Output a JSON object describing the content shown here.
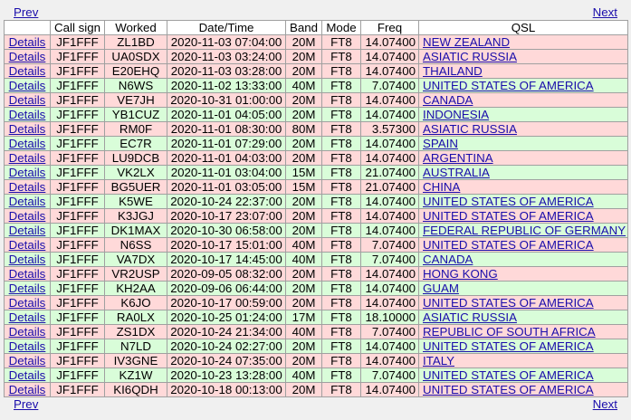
{
  "nav": {
    "prev": "Prev",
    "next": "Next"
  },
  "columns": [
    "",
    "Call sign",
    "Worked",
    "Date/Time",
    "Band",
    "Mode",
    "Freq",
    "QSL"
  ],
  "rows": [
    {
      "details": "Details",
      "call": "JF1FFF",
      "worked": "ZL1BD",
      "datetime": "2020-11-03 07:04:00",
      "band": "20M",
      "mode": "FT8",
      "freq": "14.07400",
      "qsl": "NEW ZEALAND",
      "status": "pink"
    },
    {
      "details": "Details",
      "call": "JF1FFF",
      "worked": "UA0SDX",
      "datetime": "2020-11-03 03:24:00",
      "band": "20M",
      "mode": "FT8",
      "freq": "14.07400",
      "qsl": "ASIATIC RUSSIA",
      "status": "pink"
    },
    {
      "details": "Details",
      "call": "JF1FFF",
      "worked": "E20EHQ",
      "datetime": "2020-11-03 03:28:00",
      "band": "20M",
      "mode": "FT8",
      "freq": "14.07400",
      "qsl": "THAILAND",
      "status": "pink"
    },
    {
      "details": "Details",
      "call": "JF1FFF",
      "worked": "N6WS",
      "datetime": "2020-11-02 13:33:00",
      "band": "40M",
      "mode": "FT8",
      "freq": "7.07400",
      "qsl": "UNITED STATES OF AMERICA",
      "status": "green"
    },
    {
      "details": "Details",
      "call": "JF1FFF",
      "worked": "VE7JH",
      "datetime": "2020-10-31 01:00:00",
      "band": "20M",
      "mode": "FT8",
      "freq": "14.07400",
      "qsl": "CANADA",
      "status": "pink"
    },
    {
      "details": "Details",
      "call": "JF1FFF",
      "worked": "YB1CUZ",
      "datetime": "2020-11-01 04:05:00",
      "band": "20M",
      "mode": "FT8",
      "freq": "14.07400",
      "qsl": "INDONESIA",
      "status": "green"
    },
    {
      "details": "Details",
      "call": "JF1FFF",
      "worked": "RM0F",
      "datetime": "2020-11-01 08:30:00",
      "band": "80M",
      "mode": "FT8",
      "freq": "3.57300",
      "qsl": "ASIATIC RUSSIA",
      "status": "pink"
    },
    {
      "details": "Details",
      "call": "JF1FFF",
      "worked": "EC7R",
      "datetime": "2020-11-01 07:29:00",
      "band": "20M",
      "mode": "FT8",
      "freq": "14.07400",
      "qsl": "SPAIN",
      "status": "green"
    },
    {
      "details": "Details",
      "call": "JF1FFF",
      "worked": "LU9DCB",
      "datetime": "2020-11-01 04:03:00",
      "band": "20M",
      "mode": "FT8",
      "freq": "14.07400",
      "qsl": "ARGENTINA",
      "status": "pink"
    },
    {
      "details": "Details",
      "call": "JF1FFF",
      "worked": "VK2LX",
      "datetime": "2020-11-01 03:04:00",
      "band": "15M",
      "mode": "FT8",
      "freq": "21.07400",
      "qsl": "AUSTRALIA",
      "status": "green"
    },
    {
      "details": "Details",
      "call": "JF1FFF",
      "worked": "BG5UER",
      "datetime": "2020-11-01 03:05:00",
      "band": "15M",
      "mode": "FT8",
      "freq": "21.07400",
      "qsl": "CHINA",
      "status": "pink"
    },
    {
      "details": "Details",
      "call": "JF1FFF",
      "worked": "K5WE",
      "datetime": "2020-10-24 22:37:00",
      "band": "20M",
      "mode": "FT8",
      "freq": "14.07400",
      "qsl": "UNITED STATES OF AMERICA",
      "status": "green"
    },
    {
      "details": "Details",
      "call": "JF1FFF",
      "worked": "K3JGJ",
      "datetime": "2020-10-17 23:07:00",
      "band": "20M",
      "mode": "FT8",
      "freq": "14.07400",
      "qsl": "UNITED STATES OF AMERICA",
      "status": "pink"
    },
    {
      "details": "Details",
      "call": "JF1FFF",
      "worked": "DK1MAX",
      "datetime": "2020-10-30 06:58:00",
      "band": "20M",
      "mode": "FT8",
      "freq": "14.07400",
      "qsl": "FEDERAL REPUBLIC OF GERMANY",
      "status": "green"
    },
    {
      "details": "Details",
      "call": "JF1FFF",
      "worked": "N6SS",
      "datetime": "2020-10-17 15:01:00",
      "band": "40M",
      "mode": "FT8",
      "freq": "7.07400",
      "qsl": "UNITED STATES OF AMERICA",
      "status": "pink"
    },
    {
      "details": "Details",
      "call": "JF1FFF",
      "worked": "VA7DX",
      "datetime": "2020-10-17 14:45:00",
      "band": "40M",
      "mode": "FT8",
      "freq": "7.07400",
      "qsl": "CANADA",
      "status": "green"
    },
    {
      "details": "Details",
      "call": "JF1FFF",
      "worked": "VR2USP",
      "datetime": "2020-09-05 08:32:00",
      "band": "20M",
      "mode": "FT8",
      "freq": "14.07400",
      "qsl": "HONG KONG",
      "status": "pink"
    },
    {
      "details": "Details",
      "call": "JF1FFF",
      "worked": "KH2AA",
      "datetime": "2020-09-06 06:44:00",
      "band": "20M",
      "mode": "FT8",
      "freq": "14.07400",
      "qsl": "GUAM",
      "status": "green"
    },
    {
      "details": "Details",
      "call": "JF1FFF",
      "worked": "K6JO",
      "datetime": "2020-10-17 00:59:00",
      "band": "20M",
      "mode": "FT8",
      "freq": "14.07400",
      "qsl": "UNITED STATES OF AMERICA",
      "status": "pink"
    },
    {
      "details": "Details",
      "call": "JF1FFF",
      "worked": "RA0LX",
      "datetime": "2020-10-25 01:24:00",
      "band": "17M",
      "mode": "FT8",
      "freq": "18.10000",
      "qsl": "ASIATIC RUSSIA",
      "status": "green"
    },
    {
      "details": "Details",
      "call": "JF1FFF",
      "worked": "ZS1DX",
      "datetime": "2020-10-24 21:34:00",
      "band": "40M",
      "mode": "FT8",
      "freq": "7.07400",
      "qsl": "REPUBLIC OF SOUTH AFRICA",
      "status": "pink"
    },
    {
      "details": "Details",
      "call": "JF1FFF",
      "worked": "N7LD",
      "datetime": "2020-10-24 02:27:00",
      "band": "20M",
      "mode": "FT8",
      "freq": "14.07400",
      "qsl": "UNITED STATES OF AMERICA",
      "status": "green"
    },
    {
      "details": "Details",
      "call": "JF1FFF",
      "worked": "IV3GNE",
      "datetime": "2020-10-24 07:35:00",
      "band": "20M",
      "mode": "FT8",
      "freq": "14.07400",
      "qsl": "ITALY",
      "status": "pink"
    },
    {
      "details": "Details",
      "call": "JF1FFF",
      "worked": "KZ1W",
      "datetime": "2020-10-23 13:28:00",
      "band": "40M",
      "mode": "FT8",
      "freq": "7.07400",
      "qsl": "UNITED STATES OF AMERICA",
      "status": "green"
    },
    {
      "details": "Details",
      "call": "JF1FFF",
      "worked": "KI6QDH",
      "datetime": "2020-10-18 00:13:00",
      "band": "20M",
      "mode": "FT8",
      "freq": "14.07400",
      "qsl": "UNITED STATES OF AMERICA",
      "status": "pink"
    }
  ],
  "colors": {
    "pink": "#ffd9d9",
    "green": "#d9fdd9",
    "link": "#1a0dab"
  }
}
